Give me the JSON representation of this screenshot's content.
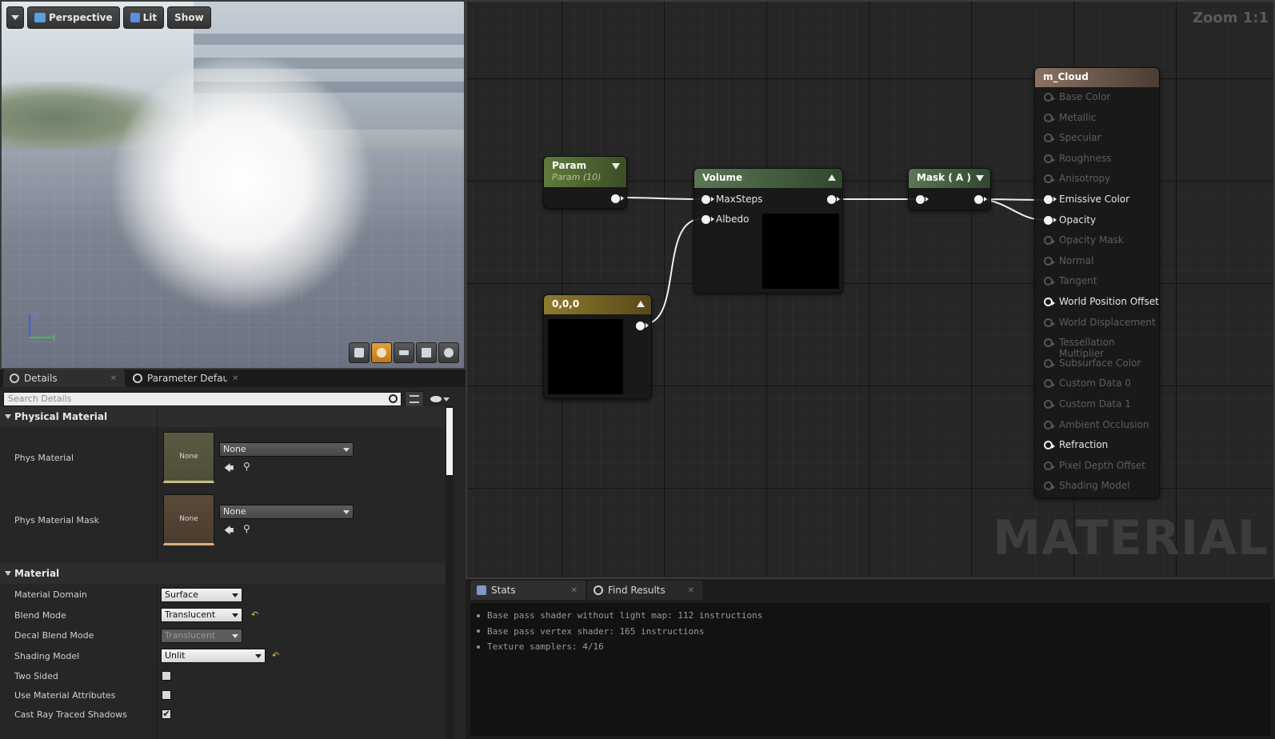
{
  "viewport": {
    "toolbar": {
      "perspective": "Perspective",
      "lit": "Lit",
      "show": "Show"
    },
    "axes": {
      "z": "Z",
      "y": "Y"
    }
  },
  "details": {
    "tabs": [
      {
        "label": "Details"
      },
      {
        "label": "Parameter Defaults"
      }
    ],
    "search_placeholder": "Search Details",
    "sections": {
      "physical_material": "Physical Material",
      "material": "Material"
    },
    "phys": {
      "phys_material_label": "Phys Material",
      "phys_material_thumb": "None",
      "phys_material_value": "None",
      "phys_mask_label": "Phys Material Mask",
      "phys_mask_thumb": "None",
      "phys_mask_value": "None"
    },
    "props": {
      "domain_label": "Material Domain",
      "domain_value": "Surface",
      "blend_label": "Blend Mode",
      "blend_value": "Translucent",
      "decal_label": "Decal Blend Mode",
      "decal_value": "Translucent",
      "shading_label": "Shading Model",
      "shading_value": "Unlit",
      "two_sided_label": "Two Sided",
      "two_sided": false,
      "use_attr_label": "Use Material Attributes",
      "use_attr": false,
      "cast_label": "Cast Ray Traced Shadows",
      "cast": true
    }
  },
  "graph": {
    "zoom": "Zoom 1:1",
    "watermark": "MATERIAL",
    "nodes": {
      "param": {
        "title": "Param",
        "subtitle": "Param (10)"
      },
      "const": {
        "title": "0,0,0"
      },
      "volume": {
        "title": "Volume",
        "in1": "MaxSteps",
        "in2": "Albedo"
      },
      "mask": {
        "title": "Mask ( A )"
      },
      "result": {
        "title": "m_Cloud",
        "inputs": [
          {
            "label": "Base Color",
            "active": false
          },
          {
            "label": "Metallic",
            "active": false
          },
          {
            "label": "Specular",
            "active": false
          },
          {
            "label": "Roughness",
            "active": false
          },
          {
            "label": "Anisotropy",
            "active": false
          },
          {
            "label": "Emissive Color",
            "active": true,
            "connected": true
          },
          {
            "label": "Opacity",
            "active": true,
            "connected": true
          },
          {
            "label": "Opacity Mask",
            "active": false
          },
          {
            "label": "Normal",
            "active": false
          },
          {
            "label": "Tangent",
            "active": false
          },
          {
            "label": "World Position Offset",
            "active": true
          },
          {
            "label": "World Displacement",
            "active": false
          },
          {
            "label": "Tessellation Multiplier",
            "active": false
          },
          {
            "label": "Subsurface Color",
            "active": false
          },
          {
            "label": "Custom Data 0",
            "active": false
          },
          {
            "label": "Custom Data 1",
            "active": false
          },
          {
            "label": "Ambient Occlusion",
            "active": false
          },
          {
            "label": "Refraction",
            "active": true
          },
          {
            "label": "Pixel Depth Offset",
            "active": false
          },
          {
            "label": "Shading Model",
            "active": false
          }
        ]
      }
    }
  },
  "stats": {
    "tabs": [
      {
        "label": "Stats"
      },
      {
        "label": "Find Results"
      }
    ],
    "lines": [
      "Base pass shader without light map: 112 instructions",
      "Base pass vertex shader: 165 instructions",
      "Texture samplers: 4/16"
    ]
  }
}
